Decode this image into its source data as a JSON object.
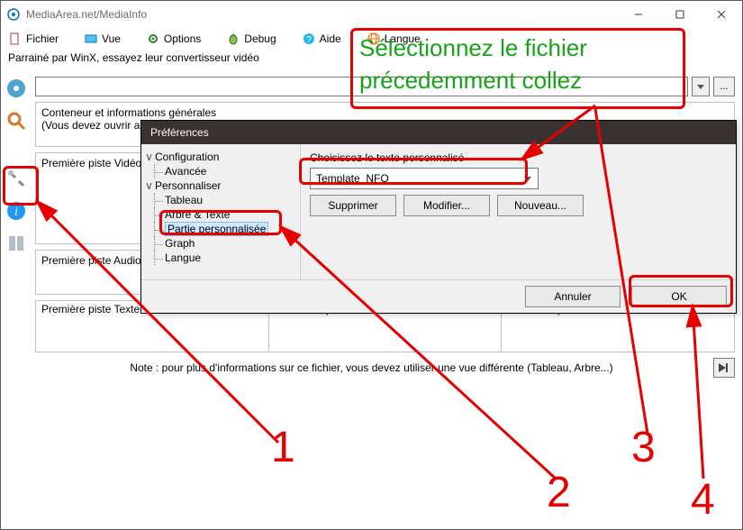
{
  "title": "MediaArea.net/MediaInfo",
  "menu": {
    "fichier": "Fichier",
    "vue": "Vue",
    "options": "Options",
    "debug": "Debug",
    "aide": "Aide",
    "langue": "Langue"
  },
  "sponsor": "Parrainé par WinX, essayez leur convertisseur vidéo",
  "container": {
    "heading": "Conteneur et informations générales",
    "sub": "(Vous devez ouvrir au moins un fichier)"
  },
  "tracks": {
    "video1": "Première piste Vidéo",
    "audio1": "Première piste Audio",
    "text1": "Première piste Texte",
    "text2": "Deuxième piste Texte",
    "text3": "Troisième piste Texte"
  },
  "note": "Note : pour plus d'informations sur ce fichier, vous devez utiliser une vue différente (Tableau, Arbre...)",
  "dialog": {
    "title": "Préférences",
    "tree": {
      "configuration": "Configuration",
      "avancee": "Avancée",
      "personnaliser": "Personnaliser",
      "tableau": "Tableau",
      "arbre_texte": "Arbre & Texte",
      "partie_perso": "Partie personnalisée",
      "graph": "Graph",
      "langue": "Langue"
    },
    "choose_label": "Choisissez le texte personnalisé",
    "combo_value": "Template_NFO",
    "buttons": {
      "supprimer": "Supprimer",
      "modifier": "Modifier...",
      "nouveau": "Nouveau..."
    },
    "footer": {
      "annuler": "Annuler",
      "ok": "OK"
    }
  },
  "annotations": {
    "green_line1": "Sélectionnez le fichier",
    "green_line2": "précedemment collez",
    "n1": "1",
    "n2": "2",
    "n3": "3",
    "n4": "4"
  },
  "colors": {
    "red": "#e60000",
    "green": "#17a317"
  }
}
